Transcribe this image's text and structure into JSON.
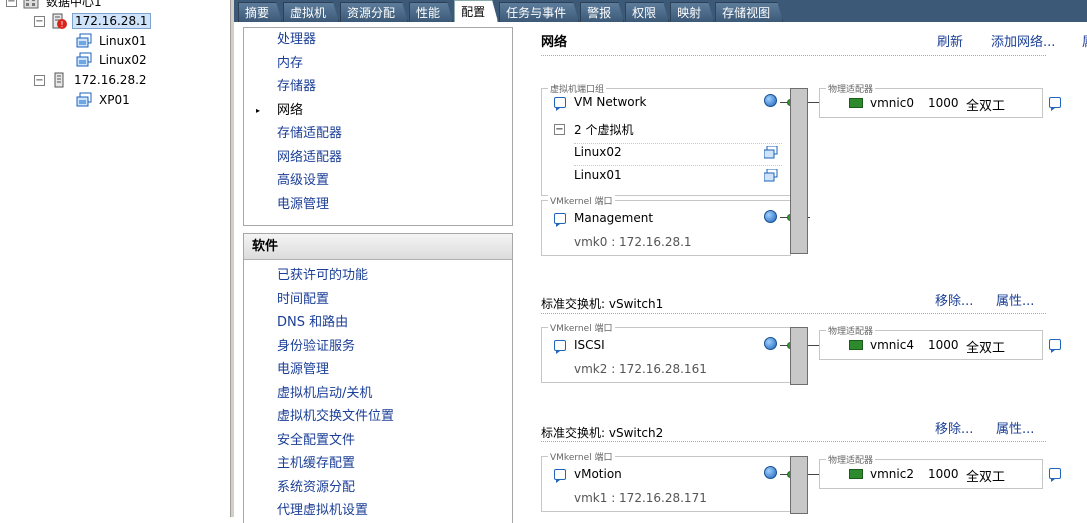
{
  "tree": {
    "datacenter": "数据中心1",
    "host1": "172.16.28.1",
    "vm1": "Linux01",
    "vm2": "Linux02",
    "host2": "172.16.28.2",
    "vm3": "XP01"
  },
  "tabs": [
    "摘要",
    "虚拟机",
    "资源分配",
    "性能",
    "配置",
    "任务与事件",
    "警报",
    "权限",
    "映射",
    "存储视图"
  ],
  "hardware": {
    "items": [
      "处理器",
      "内存",
      "存储器",
      "网络",
      "存储适配器",
      "网络适配器",
      "高级设置",
      "电源管理"
    ]
  },
  "software": {
    "header": "软件",
    "items": [
      "已获许可的功能",
      "时间配置",
      "DNS 和路由",
      "身份验证服务",
      "电源管理",
      "虚拟机启动/关机",
      "虚拟机交换文件位置",
      "安全配置文件",
      "主机缓存配置",
      "系统资源分配",
      "代理虚拟机设置"
    ]
  },
  "panel": {
    "title": "网络",
    "refresh": "刷新",
    "add_network": "添加网络...",
    "more": "属",
    "remove": "移除...",
    "properties": "属性...",
    "vm_port_group_legend": "虚拟机端口组",
    "vmkernel_legend": "VMkernel 端口",
    "physical_adapter_legend": "物理适配器",
    "vswitch0": {
      "vm_network": "VM Network",
      "vm_count": "2 个虚拟机",
      "vms": [
        "Linux02",
        "Linux01"
      ],
      "mgmt_name": "Management",
      "mgmt_ip": "vmk0 : 172.16.28.1",
      "nic": "vmnic0",
      "speed": "1000",
      "duplex": "全双工"
    },
    "vswitch1": {
      "title": "标准交换机: vSwitch1",
      "port": "ISCSI",
      "ip": "vmk2 : 172.16.28.161",
      "nic": "vmnic4",
      "speed": "1000",
      "duplex": "全双工"
    },
    "vswitch2": {
      "title": "标准交换机: vSwitch2",
      "port": "vMotion",
      "ip": "vmk1 : 172.16.28.171",
      "nic": "vmnic2",
      "speed": "1000",
      "duplex": "全双工"
    }
  },
  "icons": [
    "datacenter-icon",
    "host-alert-icon",
    "host-icon",
    "vm-icon",
    "globe-icon",
    "nic-icon",
    "comment-icon"
  ]
}
